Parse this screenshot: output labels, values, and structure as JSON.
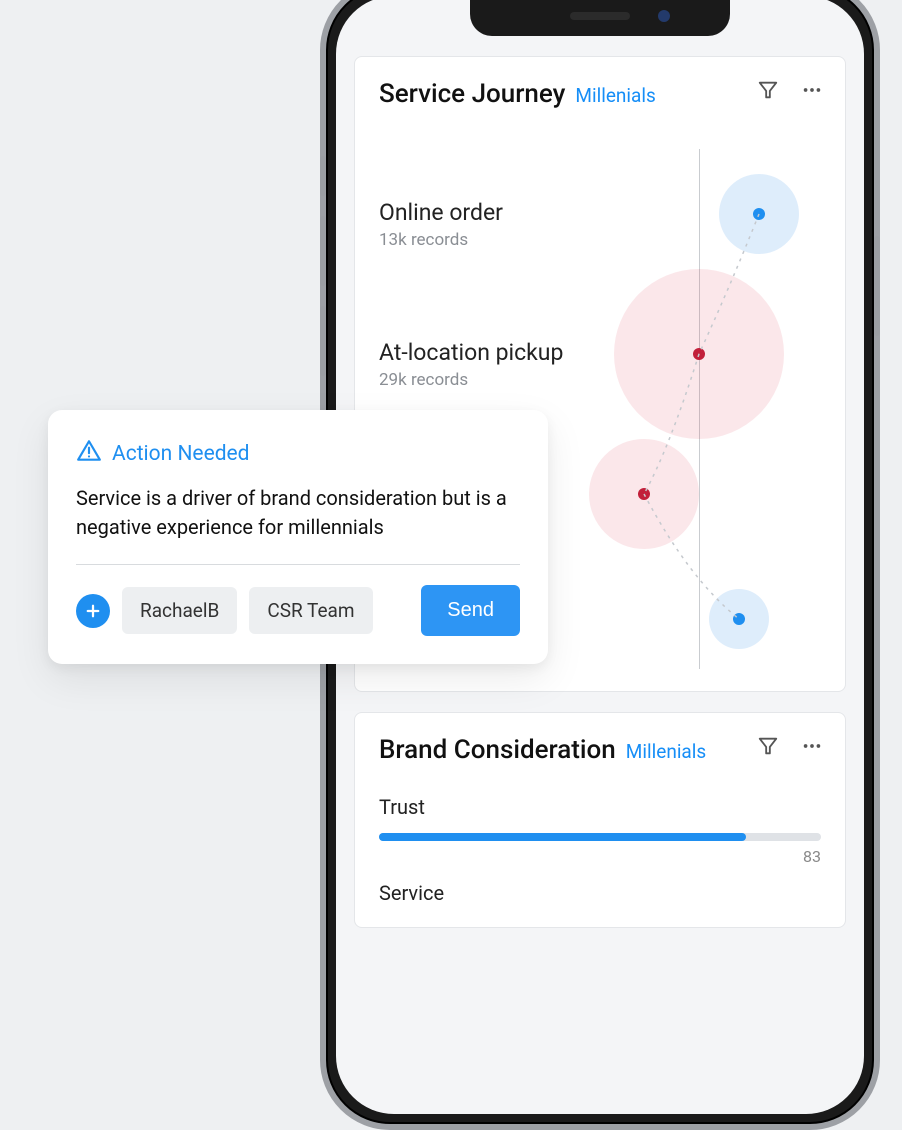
{
  "journey_card": {
    "title": "Service Journey",
    "segment": "Millenials",
    "items": [
      {
        "title": "Online order",
        "records": "13k records"
      },
      {
        "title": "At-location pickup",
        "records": "29k records"
      }
    ]
  },
  "brand_card": {
    "title": "Brand Consideration",
    "segment": "Millenials",
    "metrics": [
      {
        "name": "Trust",
        "value": 83
      },
      {
        "name": "Service",
        "value": null
      }
    ]
  },
  "popup": {
    "heading": "Action Needed",
    "message": "Service is a driver of brand consideration but is a negative experience for millennials",
    "recipients": [
      "RachaelB",
      "CSR Team"
    ],
    "send_label": "Send"
  },
  "chart_data": {
    "type": "scatter",
    "title": "Service Journey",
    "segment": "Millenials",
    "axis": "vertical timeline",
    "points": [
      {
        "label": "Online order",
        "records_k": 13,
        "sentiment": "positive",
        "size": "small",
        "onAxis": false,
        "side": "right"
      },
      {
        "label": "At-location pickup",
        "records_k": 29,
        "sentiment": "negative",
        "size": "large",
        "onAxis": true,
        "side": "center"
      },
      {
        "label": "",
        "records_k": null,
        "sentiment": "negative",
        "size": "medium",
        "onAxis": false,
        "side": "left"
      },
      {
        "label": "",
        "records_k": null,
        "sentiment": "positive",
        "size": "small",
        "onAxis": false,
        "side": "right"
      }
    ],
    "legend": {
      "positive_color": "#1f8ff0",
      "negative_color": "#c21f3a"
    }
  }
}
